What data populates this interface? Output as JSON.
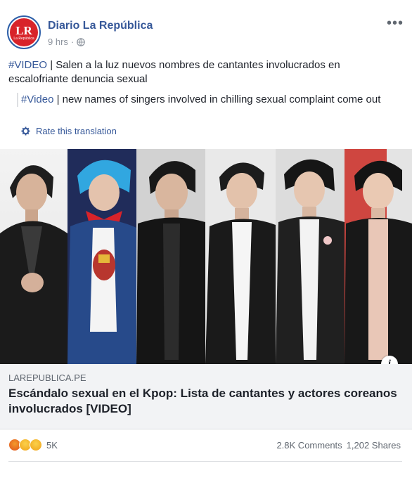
{
  "header": {
    "avatar_text": "LR",
    "avatar_subtext": "La República",
    "page_name": "Diario La República",
    "time": "9 hrs",
    "separator": "·"
  },
  "post": {
    "hashtag": "#VIDEO",
    "text": " | Salen a la luz nuevos nombres de cantantes involucrados en escalofriante denuncia sexual"
  },
  "translation": {
    "hashtag": "#Video",
    "text": " | new names of singers involved in chilling sexual complaint come out",
    "rate_label": "Rate this translation"
  },
  "link": {
    "domain": "LAREPUBLICA.PE",
    "title": "Escándalo sexual en el Kpop: Lista de cantantes y actores coreanos involucrados [VIDEO]",
    "info_icon": "i"
  },
  "engagement": {
    "reactions_count": "5K",
    "comments": "2.8K Comments",
    "shares": "1,202 Shares"
  },
  "colors": {
    "link_blue": "#365899",
    "angry": "#e9710f",
    "haha": "#f7b125",
    "wow": "#f7b125"
  }
}
